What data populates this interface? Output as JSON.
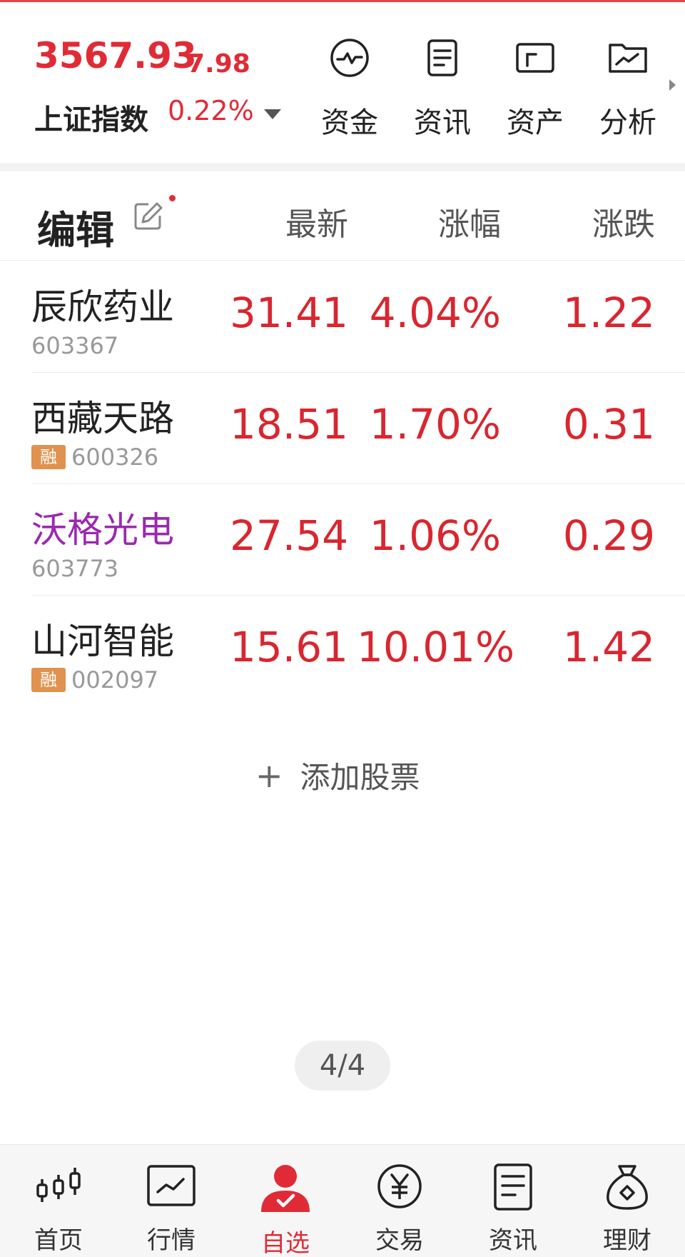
{
  "index": {
    "price": "3567.93",
    "change": "7.98",
    "name": "上证指数",
    "pct": "0.22%"
  },
  "quick_links": [
    {
      "label": "资金",
      "icon": "pulse-circle-icon"
    },
    {
      "label": "资讯",
      "icon": "document-icon"
    },
    {
      "label": "资产",
      "icon": "wallet-icon"
    },
    {
      "label": "分析",
      "icon": "folder-chart-icon"
    }
  ],
  "list_header": {
    "edit": "编辑",
    "col_latest": "最新",
    "col_pct": "涨幅",
    "col_change": "涨跌"
  },
  "stocks": [
    {
      "name": "辰欣药业",
      "code": "603367",
      "badge": "",
      "latest": "31.41",
      "pct": "4.04%",
      "change": "1.22",
      "name_color": "#222222"
    },
    {
      "name": "西藏天路",
      "code": "600326",
      "badge": "融",
      "latest": "18.51",
      "pct": "1.70%",
      "change": "0.31",
      "name_color": "#222222"
    },
    {
      "name": "沃格光电",
      "code": "603773",
      "badge": "",
      "latest": "27.54",
      "pct": "1.06%",
      "change": "0.29",
      "name_color": "#9b28b0"
    },
    {
      "name": "山河智能",
      "code": "002097",
      "badge": "融",
      "latest": "15.61",
      "pct": "10.01%",
      "change": "1.42",
      "name_color": "#222222"
    }
  ],
  "add_stock": "添加股票",
  "pager": "4/4",
  "nav": [
    {
      "label": "首页",
      "icon": "candlestick-icon"
    },
    {
      "label": "行情",
      "icon": "chart-line-icon"
    },
    {
      "label": "自选",
      "icon": "user-check-icon"
    },
    {
      "label": "交易",
      "icon": "yen-circle-icon"
    },
    {
      "label": "资讯",
      "icon": "document-icon"
    },
    {
      "label": "理财",
      "icon": "money-bag-icon"
    }
  ],
  "colors": {
    "up_red": "#d9262f",
    "brand_red": "#e02b36",
    "badge_orange": "#e0924e"
  }
}
